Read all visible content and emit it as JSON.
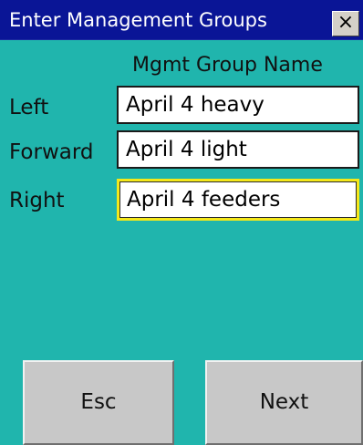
{
  "window": {
    "title": "Enter Management Groups",
    "close_glyph": "×"
  },
  "form": {
    "column_header": "Mgmt Group Name",
    "rows": [
      {
        "label": "Left",
        "value": "April 4 heavy"
      },
      {
        "label": "Forward",
        "value": "April 4 light"
      },
      {
        "label": "Right",
        "value": "April 4 feeders"
      }
    ],
    "active_row_index": 2
  },
  "buttons": {
    "esc_label": "Esc",
    "next_label": "Next"
  },
  "colors": {
    "background": "#20b5ad",
    "titlebar": "#0a1596",
    "active_field_border": "#f5e81a",
    "button_face": "#c8c8c8"
  }
}
